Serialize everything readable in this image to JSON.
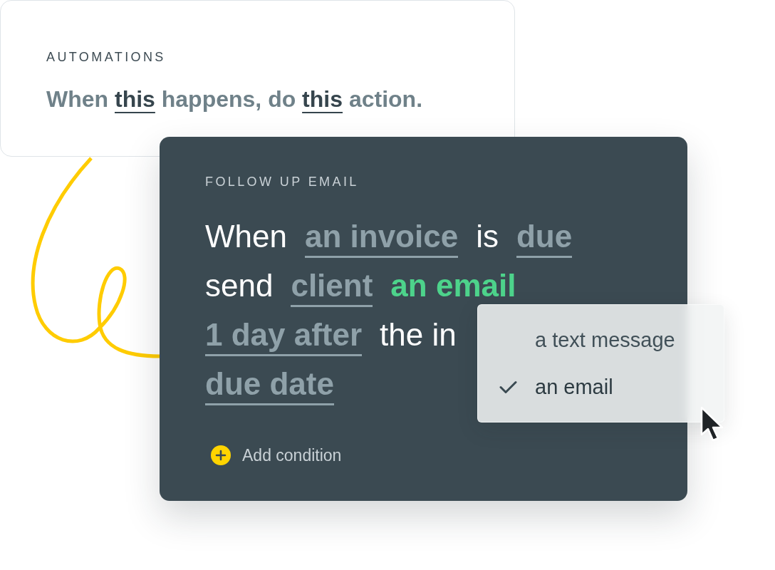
{
  "intro_card": {
    "label": "AUTOMATIONS",
    "headline": "When **this** happens, do **this** action."
  },
  "rule_card": {
    "label": "FOLLOW UP EMAIL",
    "lines": [
      [
        {
          "kind": "plain",
          "text": "When"
        },
        {
          "kind": "choice",
          "text": "an invoice"
        },
        {
          "kind": "plain",
          "text": "is"
        },
        {
          "kind": "choice",
          "text": "due"
        }
      ],
      [
        {
          "kind": "plain",
          "text": "send"
        },
        {
          "kind": "choice",
          "text": "client"
        },
        {
          "kind": "picked",
          "text": "an email"
        }
      ],
      [
        {
          "kind": "choice",
          "text": "1 day after"
        },
        {
          "kind": "plain",
          "text": "the in"
        }
      ],
      [
        {
          "kind": "choice",
          "text": "due date"
        }
      ]
    ],
    "add_button": "Add condition"
  },
  "dropdown": {
    "options": [
      {
        "label": "a text message",
        "selected": false
      },
      {
        "label": "an email",
        "selected": true
      }
    ]
  }
}
